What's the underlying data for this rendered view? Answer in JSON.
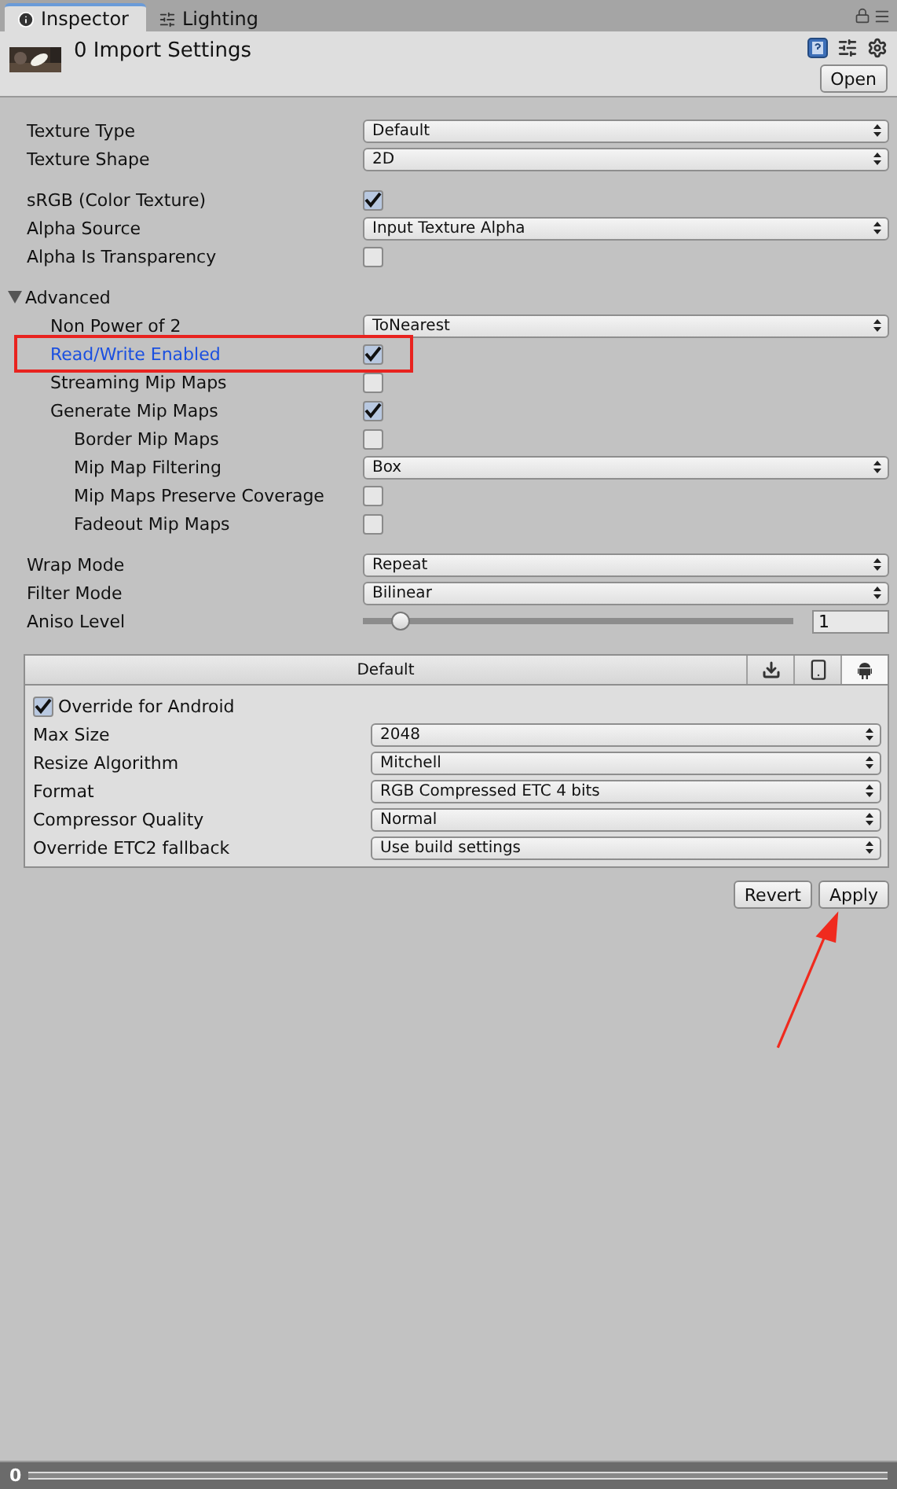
{
  "tabs": [
    {
      "label": "Inspector",
      "kind": "info",
      "selected": true
    },
    {
      "label": "Lighting",
      "kind": "sliders",
      "selected": false
    }
  ],
  "header": {
    "title": "0 Import Settings",
    "button": "Open"
  },
  "groups": [
    [
      {
        "kind": "dropdown",
        "label": "Texture Type",
        "value": "Default"
      },
      {
        "kind": "dropdown",
        "label": "Texture Shape",
        "value": "2D"
      }
    ],
    [
      {
        "kind": "checkbox",
        "label": "sRGB (Color Texture)",
        "checked": true
      },
      {
        "kind": "dropdown",
        "label": "Alpha Source",
        "value": "Input Texture Alpha"
      },
      {
        "kind": "checkbox",
        "label": "Alpha Is Transparency",
        "checked": false
      }
    ],
    [
      {
        "kind": "foldout",
        "label": "Advanced",
        "expanded": true,
        "children": [
          {
            "kind": "dropdown",
            "label": "Non Power of 2",
            "value": "ToNearest"
          },
          {
            "kind": "checkbox",
            "label": "Read/Write Enabled",
            "checked": true,
            "highlighted": true
          },
          {
            "kind": "checkbox",
            "label": "Streaming Mip Maps",
            "checked": false
          },
          {
            "kind": "checkbox",
            "label": "Generate Mip Maps",
            "checked": true,
            "children": [
              {
                "kind": "checkbox",
                "label": "Border Mip Maps",
                "checked": false
              },
              {
                "kind": "dropdown",
                "label": "Mip Map Filtering",
                "value": "Box"
              },
              {
                "kind": "checkbox",
                "label": "Mip Maps Preserve Coverage",
                "checked": false
              },
              {
                "kind": "checkbox",
                "label": "Fadeout Mip Maps",
                "checked": false
              }
            ]
          }
        ]
      }
    ],
    [
      {
        "kind": "dropdown",
        "label": "Wrap Mode",
        "value": "Repeat"
      },
      {
        "kind": "dropdown",
        "label": "Filter Mode",
        "value": "Bilinear"
      },
      {
        "kind": "slider",
        "label": "Aniso Level",
        "level": 0.07,
        "value": "1"
      }
    ]
  ],
  "platforms": {
    "tabs": [
      {
        "kind": "text",
        "label": "Default",
        "selected": false
      },
      {
        "kind": "download",
        "selected": false
      },
      {
        "kind": "mobile",
        "selected": false
      },
      {
        "kind": "android",
        "selected": true
      }
    ],
    "override": {
      "label": "Override for Android",
      "checked": true
    },
    "rows": [
      {
        "label": "Max Size",
        "value": "2048"
      },
      {
        "label": "Resize Algorithm",
        "value": "Mitchell"
      },
      {
        "label": "Format",
        "value": "RGB Compressed ETC 4 bits"
      },
      {
        "label": "Compressor Quality",
        "value": "Normal"
      },
      {
        "label": "Override ETC2 fallback",
        "value": "Use build settings"
      }
    ]
  },
  "buttons": [
    "Revert",
    "Apply"
  ],
  "pointer_arrow": true,
  "footer": {
    "label": "0"
  }
}
